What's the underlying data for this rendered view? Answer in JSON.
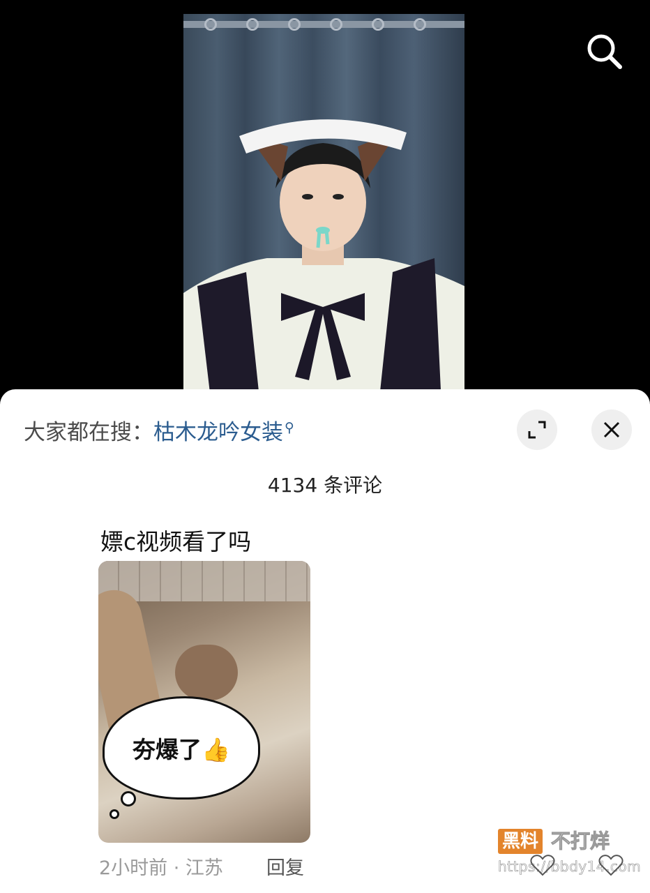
{
  "video": {
    "search_icon": "search-icon"
  },
  "sheet": {
    "trending_prefix": "大家都在搜：",
    "trending_term": "枯木龙吟女装",
    "trending_icon": "search-small-icon",
    "expand_icon": "expand-icon",
    "close_icon": "close-icon",
    "comment_count": "4134 条评论"
  },
  "comment": {
    "text": "嫖c视频看了吗",
    "image_caption": "夯爆了👍",
    "time_location": "2小时前 · 江苏",
    "reply_label": "回复"
  },
  "watermark": {
    "badge": "黑料",
    "title": "不打烊",
    "url": "https://bbdy14.com"
  },
  "colors": {
    "accent_link": "#2b5c8f",
    "watermark_orange": "#e3842c"
  }
}
